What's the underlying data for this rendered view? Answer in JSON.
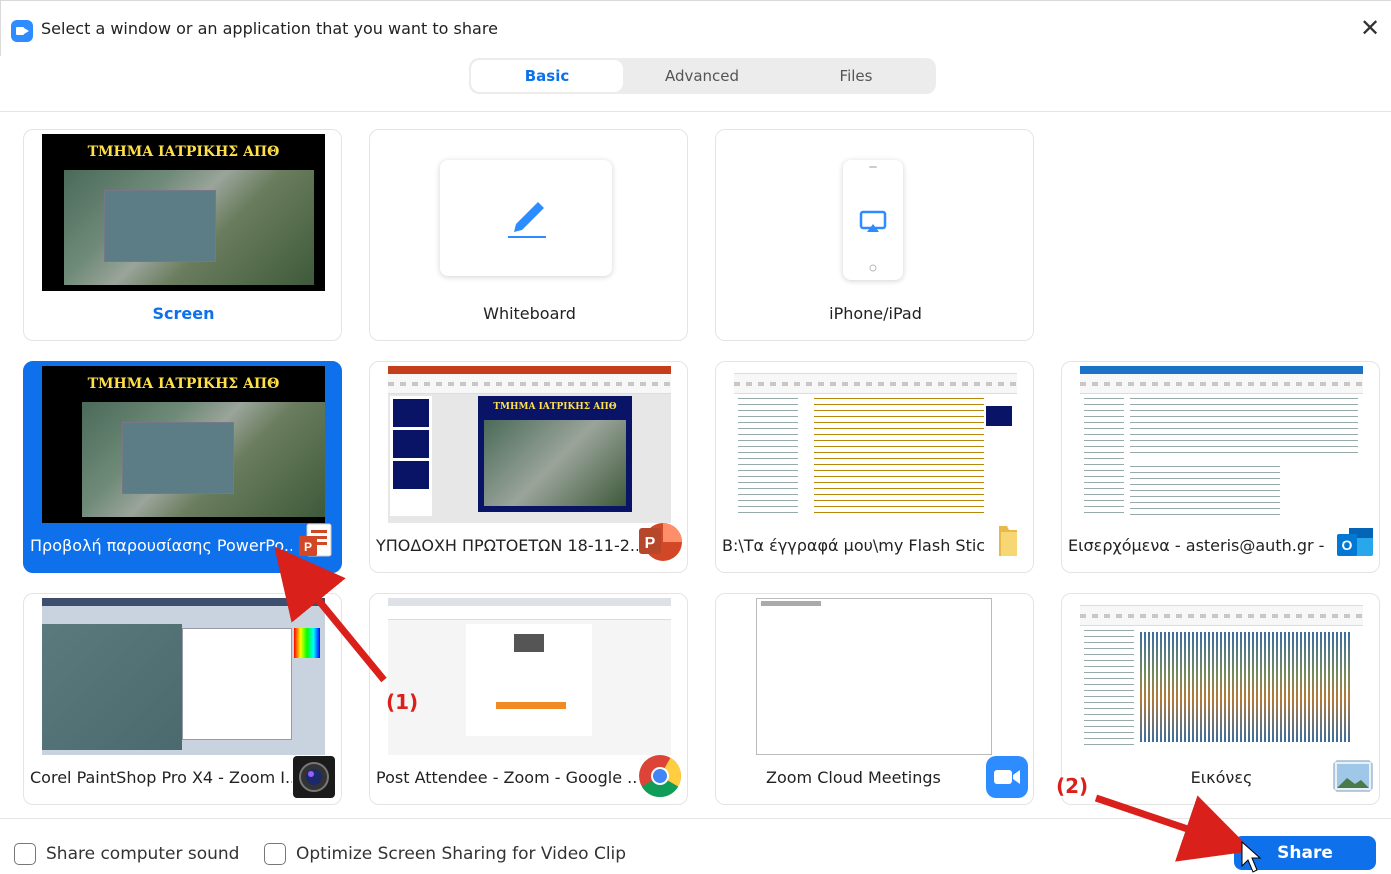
{
  "window": {
    "title": "Select a window or an application that you want to share",
    "close": "✕"
  },
  "tabs": [
    {
      "label": "Basic",
      "active": true
    },
    {
      "label": "Advanced",
      "active": false
    },
    {
      "label": "Files",
      "active": false
    }
  ],
  "tiles": {
    "screen": {
      "label": "Screen",
      "slide_title": "ΤΜΗΜΑ ΙΑΤΡΙΚΗΣ ΑΠΘ"
    },
    "whiteboard": {
      "label": "Whiteboard"
    },
    "iphone": {
      "label": "iPhone/iPad"
    },
    "ppt_show": {
      "label": "Προβολή παρουσίασης PowerPo...",
      "slide_title": "ΤΜΗΜΑ ΙΑΤΡΙΚΗΣ ΑΠΘ",
      "selected": true
    },
    "ppt_edit": {
      "label": "ΥΠΟΔΟΧΗ ΠΡΩΤΟΕΤΩΝ 18-11-2...",
      "slide_title": "ΤΜΗΜΑ ΙΑΤΡΙΚΗΣ ΑΠΘ"
    },
    "explorer": {
      "label": "B:\\Τα έγγραφά μου\\my Flash Stick"
    },
    "outlook": {
      "label": "Εισερχόμενα - asteris@auth.gr - ..."
    },
    "paintshop": {
      "label": "Corel PaintShop Pro X4 - Zoom I..."
    },
    "chrome": {
      "label": "Post Attendee - Zoom - Google ..."
    },
    "zoom": {
      "label": "Zoom Cloud Meetings"
    },
    "pictures": {
      "label": "Εικόνες"
    }
  },
  "footer": {
    "share_sound": "Share computer sound",
    "optimize": "Optimize Screen Sharing for Video Clip",
    "share_button": "Share"
  },
  "annotations": {
    "step1": "(1)",
    "step2": "(2)"
  },
  "colors": {
    "accent": "#0e71eb",
    "annotation": "#d9201a"
  }
}
